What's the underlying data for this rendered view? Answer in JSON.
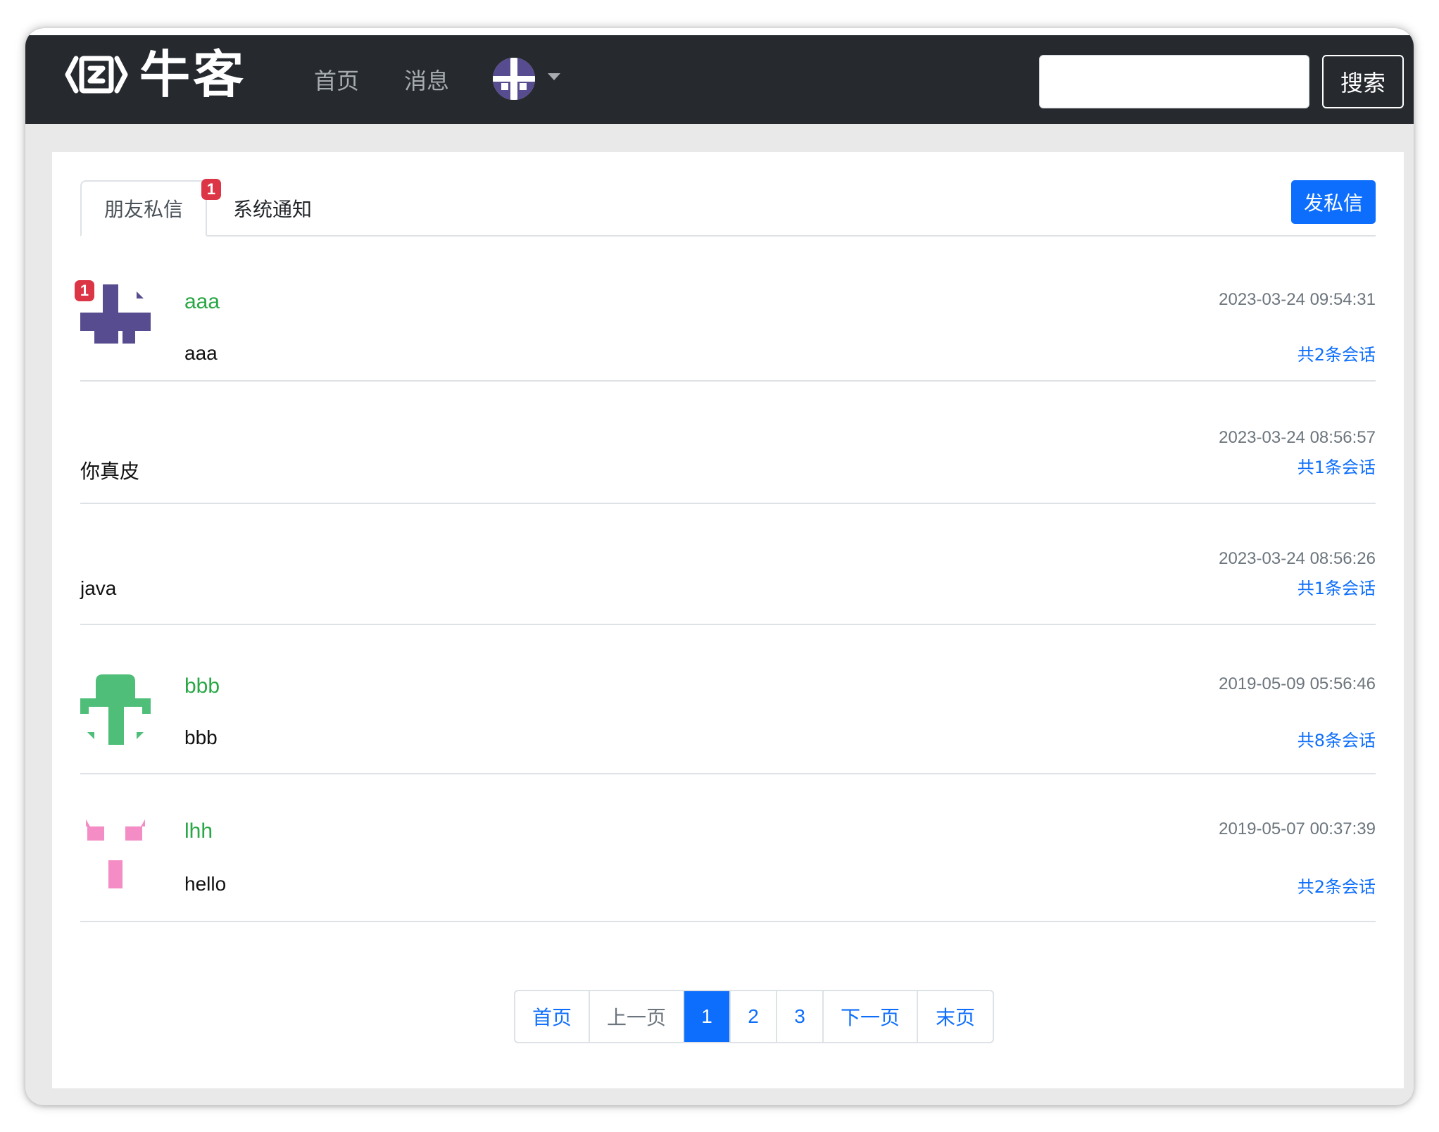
{
  "header": {
    "logo_text": "牛客",
    "nav": [
      "首页",
      "消息"
    ],
    "search_placeholder": "",
    "search_button": "搜索"
  },
  "tabs": {
    "friends_label": "朋友私信",
    "friends_unread": "1",
    "system_label": "系统通知"
  },
  "send_button": "发私信",
  "conversations": [
    {
      "name": "aaa",
      "text": "aaa",
      "time": "2023-03-24 09:54:31",
      "count": "共2条会话",
      "unread": "1",
      "avatar_color": "#574c8f"
    },
    {
      "name": "",
      "text": "你真皮",
      "time": "2023-03-24 08:56:57",
      "count": "共1条会话"
    },
    {
      "name": "",
      "text": "java",
      "time": "2023-03-24 08:56:26",
      "count": "共1条会话"
    },
    {
      "name": "bbb",
      "text": "bbb",
      "time": "2019-05-09 05:56:46",
      "count": "共8条会话",
      "avatar_color": "#4fbe79"
    },
    {
      "name": "lhh",
      "text": "hello",
      "time": "2019-05-07 00:37:39",
      "count": "共2条会话",
      "avatar_color": "#f48cc5"
    }
  ],
  "pagination": {
    "first": "首页",
    "prev": "上一页",
    "pages": [
      "1",
      "2",
      "3"
    ],
    "current": "1",
    "next": "下一页",
    "last": "末页"
  },
  "colors": {
    "navbar": "#262a2f",
    "primary": "#0d6efd",
    "username": "#28a745",
    "badge": "#dc3545"
  }
}
